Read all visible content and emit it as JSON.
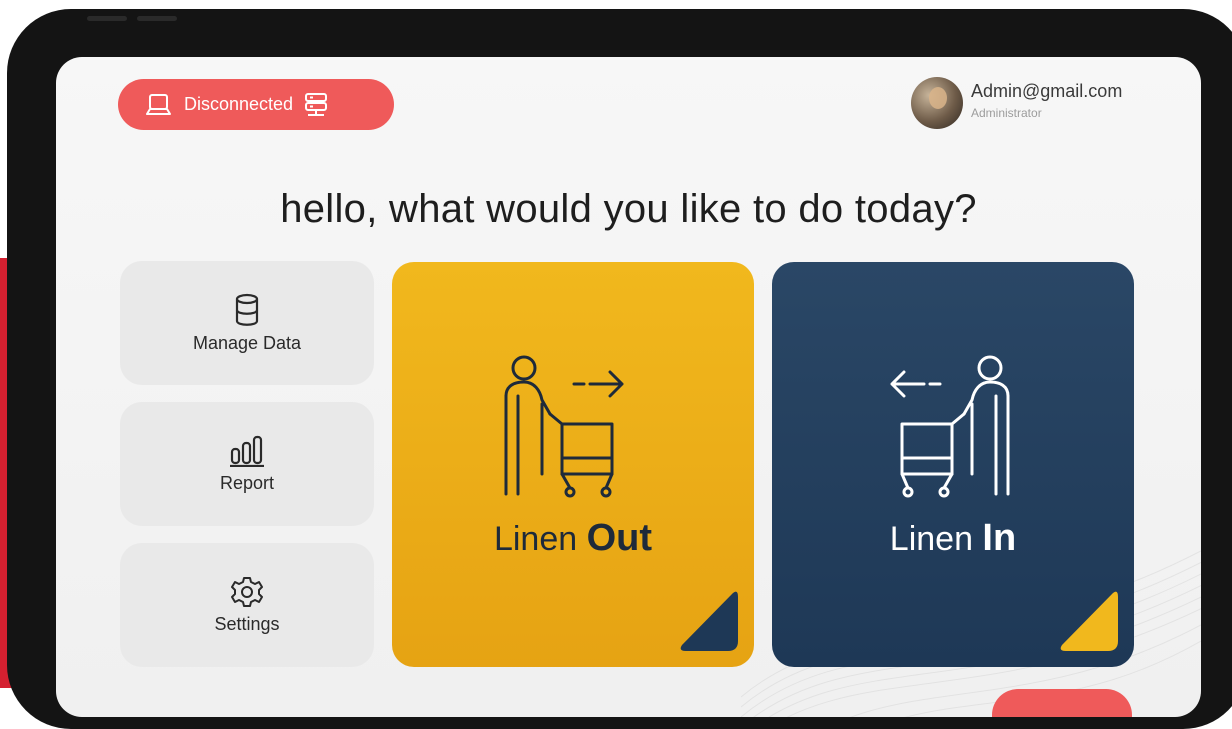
{
  "status": {
    "label": "Disconnected",
    "color": "#ef5a5a"
  },
  "user": {
    "email": "Admin@gmail.com",
    "role": "Administrator"
  },
  "greeting": "hello, what would you like to do today?",
  "menu": [
    {
      "label": "Manage Data",
      "icon": "database-icon"
    },
    {
      "label": "Report",
      "icon": "bar-chart-icon"
    },
    {
      "label": "Settings",
      "icon": "gear-icon"
    }
  ],
  "cards": {
    "out": {
      "prefix": "Linen ",
      "emphasis": "Out",
      "color": "#f1b81d"
    },
    "in": {
      "prefix": "Linen ",
      "emphasis": "In",
      "color": "#1e3856"
    }
  }
}
